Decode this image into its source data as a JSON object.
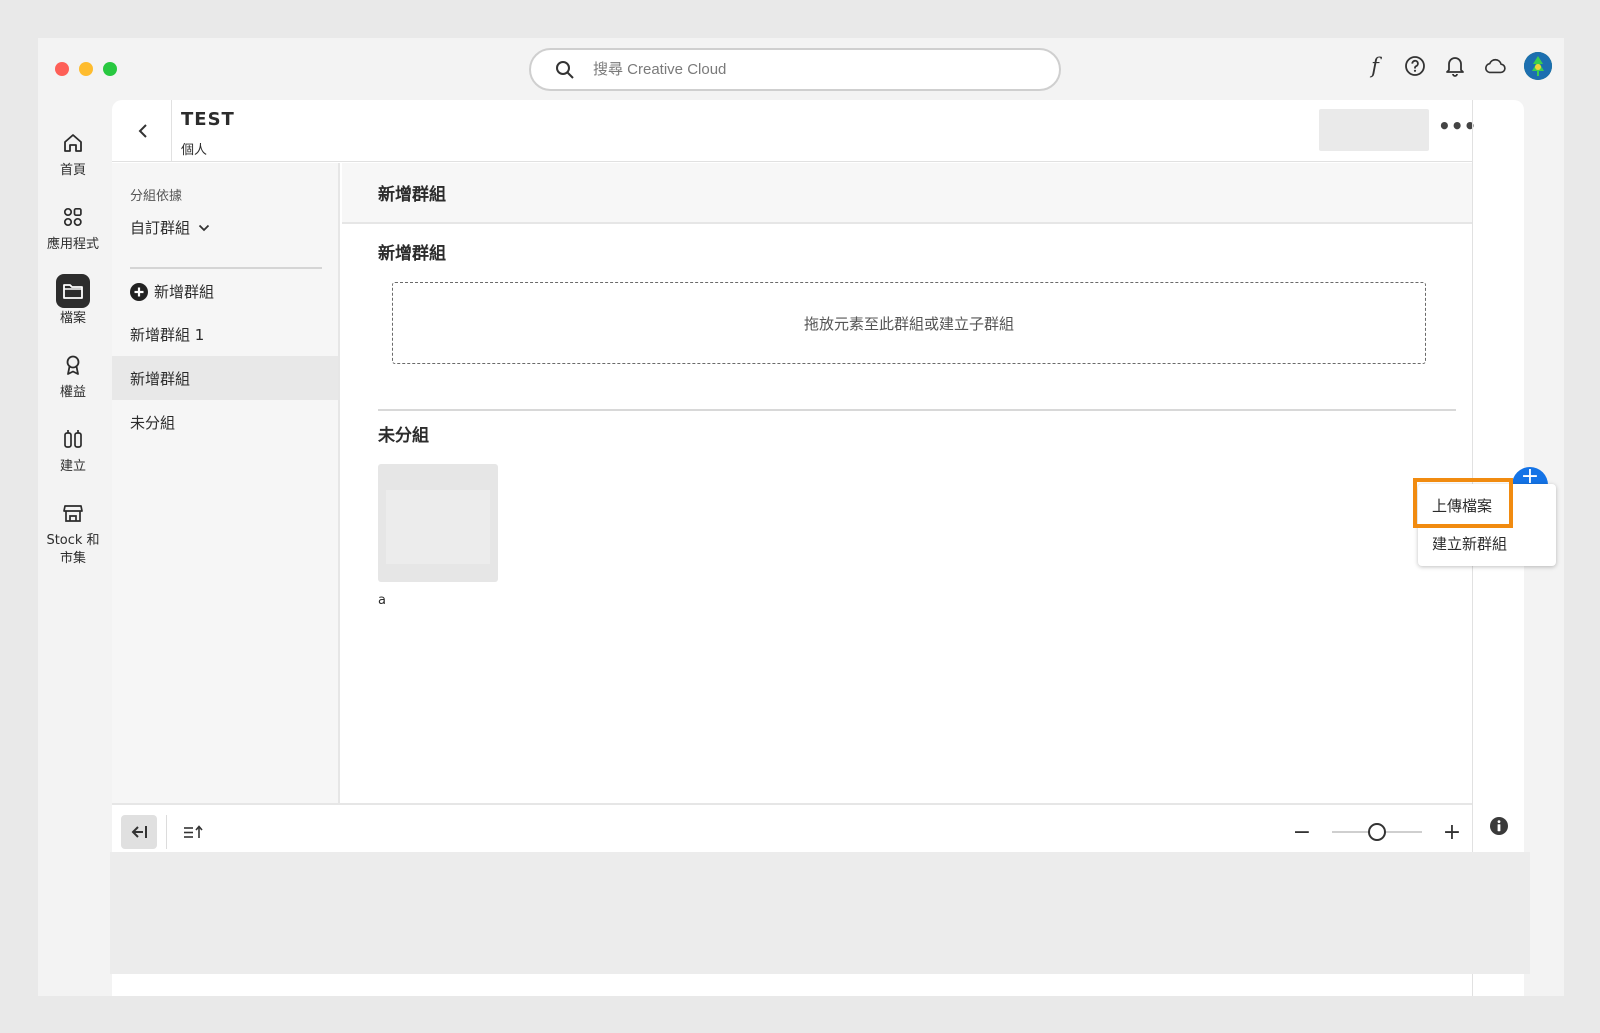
{
  "search": {
    "placeholder": "搜尋 Creative Cloud"
  },
  "topbar": {
    "font_glyph": "f"
  },
  "rail": {
    "items": [
      {
        "label": "首頁",
        "icon": "home-icon"
      },
      {
        "label": "應用程式",
        "icon": "apps-icon"
      },
      {
        "label": "檔案",
        "icon": "folder-icon",
        "active": true
      },
      {
        "label": "權益",
        "icon": "badge-icon"
      },
      {
        "label": "建立",
        "icon": "create-icon"
      },
      {
        "label": "Stock 和 市集",
        "icon": "store-icon"
      }
    ]
  },
  "header": {
    "title": "TEST",
    "subtitle": "個人",
    "more_label": "•••"
  },
  "sidebar": {
    "group_by_label": "分組依據",
    "group_by_value": "自訂群組",
    "add_group_label": "新增群組",
    "items": [
      {
        "label": "新增群組 1"
      },
      {
        "label": "新增群組"
      },
      {
        "label": "未分組"
      }
    ]
  },
  "main": {
    "heading": "新增群組",
    "group_title": "新增群組",
    "drop_text": "拖放元素至此群組或建立子群組",
    "ungrouped_title": "未分組",
    "file_name": "a"
  },
  "footer": {
    "zoom_minus": "−",
    "zoom_plus": "+",
    "zoom_level": 0.5
  },
  "fab": {
    "label": "+"
  },
  "context_menu": {
    "items": [
      {
        "label": "上傳檔案"
      },
      {
        "label": "建立新群組"
      }
    ]
  },
  "colors": {
    "accent": "#1473e6",
    "highlight": "#f18b10"
  }
}
